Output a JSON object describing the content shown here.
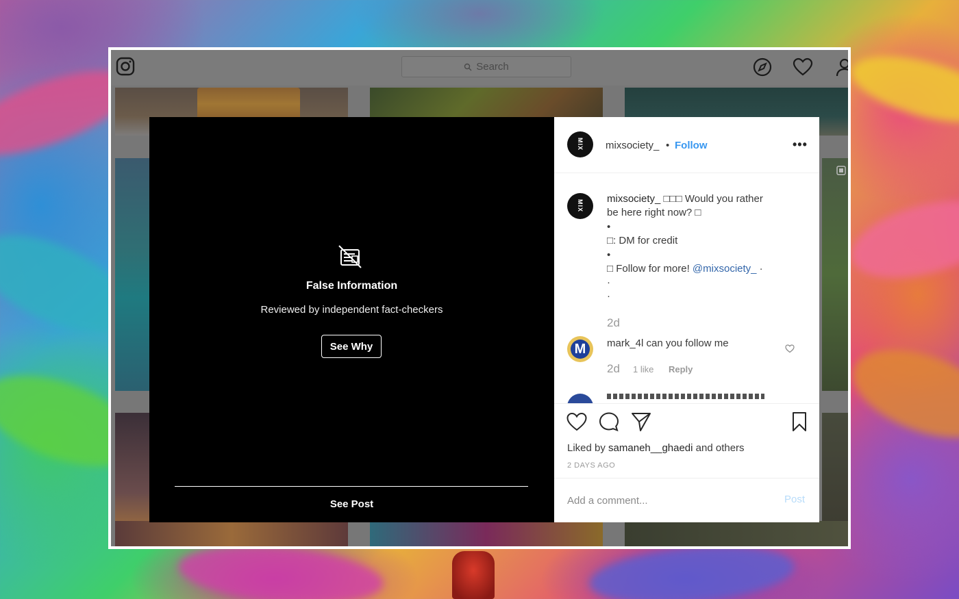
{
  "nav": {
    "search_placeholder": "Search"
  },
  "media": {
    "title": "False Information",
    "subtitle": "Reviewed by independent fact-checkers",
    "see_why_label": "See Why",
    "see_post_label": "See Post"
  },
  "header": {
    "username": "mixsociety_",
    "separator": "•",
    "follow_label": "Follow",
    "more_label": "•••"
  },
  "caption": {
    "line1_user": "mixsociety_",
    "line1_text": " □□□ Would you rather",
    "line2": "be here right now? □",
    "line3": "•",
    "line4": "□: DM for credit",
    "line5": "•",
    "line6_text": "□ Follow for more! ",
    "line6_mention": "@mixsociety_",
    "line6_tail": " ·",
    "line7": "·",
    "line8": "·",
    "time": "2d"
  },
  "comment": {
    "user": "mark_4l",
    "text": "can you follow me",
    "time": "2d",
    "likes": "1 like",
    "reply_label": "Reply"
  },
  "actions": {
    "liked_prefix": "Liked by ",
    "liked_user": "samaneh__ghaedi",
    "liked_suffix": " and others",
    "date": "2 DAYS AGO"
  },
  "add_comment": {
    "placeholder": "Add a comment...",
    "post_label": "Post"
  },
  "colors": {
    "link_blue": "#3897f0",
    "post_disabled": "#b8dcfa",
    "media_bg": "#000000"
  }
}
